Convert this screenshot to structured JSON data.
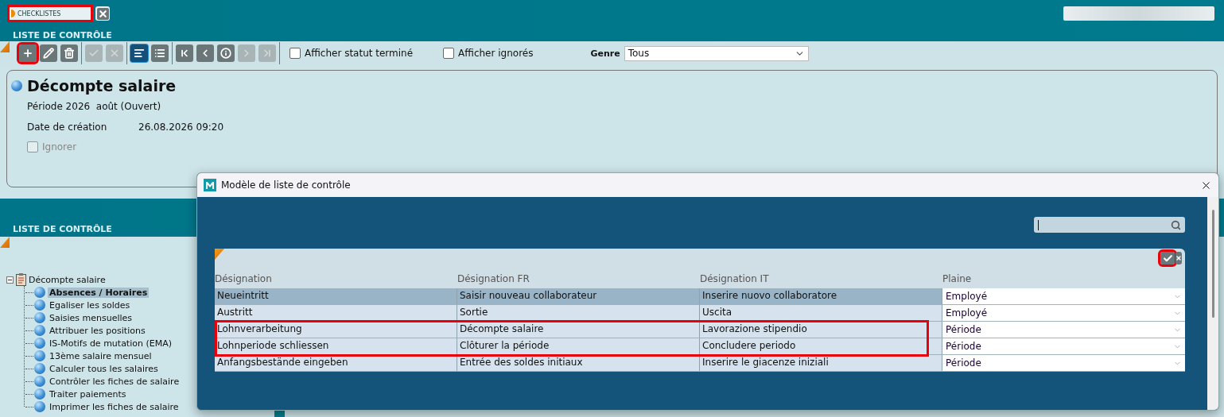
{
  "tab": {
    "label": "CHECKLISTES",
    "highlighted": true
  },
  "section_title": "LISTE DE CONTRÔLE",
  "toolbar": {
    "groups": [
      [
        {
          "kind": "add",
          "disabled": false,
          "selected": false,
          "highlighted": true
        },
        {
          "kind": "edit",
          "disabled": false,
          "selected": false,
          "highlighted": false
        },
        {
          "kind": "delete",
          "disabled": false,
          "selected": false,
          "highlighted": false
        }
      ],
      [
        {
          "kind": "confirm",
          "disabled": true,
          "selected": false,
          "highlighted": false
        },
        {
          "kind": "cancel",
          "disabled": true,
          "selected": false,
          "highlighted": false
        }
      ],
      [
        {
          "kind": "detail",
          "disabled": false,
          "selected": true,
          "highlighted": false
        },
        {
          "kind": "list",
          "disabled": false,
          "selected": false,
          "highlighted": false
        }
      ],
      [
        {
          "kind": "first",
          "disabled": false,
          "selected": false,
          "highlighted": false
        },
        {
          "kind": "previous",
          "disabled": false,
          "selected": false,
          "highlighted": false
        },
        {
          "kind": "info",
          "disabled": false,
          "selected": false,
          "highlighted": false
        },
        {
          "kind": "next",
          "disabled": true,
          "selected": false,
          "highlighted": false
        },
        {
          "kind": "last",
          "disabled": true,
          "selected": false,
          "highlighted": false
        }
      ]
    ],
    "checkboxes": [
      {
        "label": "Afficher statut terminé",
        "checked": false
      },
      {
        "label": "Afficher ignorés",
        "checked": false
      }
    ],
    "genre": {
      "label": "Genre",
      "value": "Tous"
    }
  },
  "detail": {
    "title": "Décompte salaire",
    "period": "Période 2026  août (Ouvert)",
    "fields": [
      {
        "label": "Date de création",
        "value": "26.08.2026 09:20"
      }
    ],
    "ignore": {
      "label": "Ignorer",
      "checked": false,
      "disabled": true
    }
  },
  "tree": {
    "section_title": "LISTE DE CONTRÔLE",
    "root": {
      "label": "Décompte salaire",
      "expanded": true,
      "children": [
        {
          "label": "Absences / Horaires",
          "selected": true
        },
        {
          "label": "Egaliser les soldes",
          "selected": false
        },
        {
          "label": "Saisies mensuelles",
          "selected": false
        },
        {
          "label": "Attribuer les positions",
          "selected": false
        },
        {
          "label": "IS-Motifs de mutation (EMA)",
          "selected": false
        },
        {
          "label": "13ème salaire mensuel",
          "selected": false
        },
        {
          "label": "Calculer tous les salaires",
          "selected": false
        },
        {
          "label": "Contrôler les fiches de salaire",
          "selected": false
        },
        {
          "label": "Traiter paiements",
          "selected": false
        },
        {
          "label": "Imprimer les fiches de salaire",
          "selected": false
        }
      ]
    }
  },
  "dialog": {
    "title": "Modèle de liste de contrôle",
    "confirm_highlighted": true,
    "columns": [
      "Désignation",
      "Désignation FR",
      "Désignation IT",
      "Plaine"
    ],
    "rows": [
      {
        "cells": [
          "Neueintritt",
          "Saisir nouveau collaborateur",
          "Inserire nuovo collaboratore"
        ],
        "plaine": "Employé",
        "selected": true,
        "highlighted": false
      },
      {
        "cells": [
          "Austritt",
          "Sortie",
          "Uscita"
        ],
        "plaine": "Employé",
        "selected": false,
        "highlighted": false
      },
      {
        "cells": [
          "Lohnverarbeitung",
          "Décompte salaire",
          "Lavorazione stipendio"
        ],
        "plaine": "Période",
        "selected": false,
        "highlighted": true
      },
      {
        "cells": [
          "Lohnperiode schliessen",
          "Clôturer la période",
          "Concludere periodo"
        ],
        "plaine": "Période",
        "selected": false,
        "highlighted": true
      },
      {
        "cells": [
          "Anfangsbestände eingeben",
          "Entrée des soldes initiaux",
          "Inserire le giacenze iniziali"
        ],
        "plaine": "Période",
        "selected": false,
        "highlighted": false
      }
    ]
  }
}
